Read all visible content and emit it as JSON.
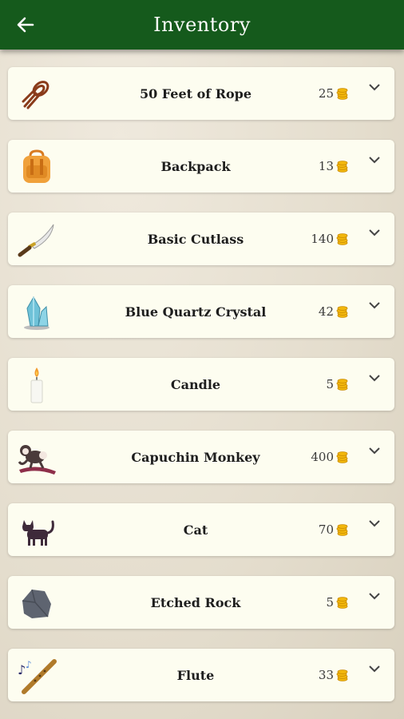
{
  "header": {
    "title": "Inventory",
    "back_icon": "arrow-left-icon",
    "bar_color": "#155a1c"
  },
  "items": [
    {
      "name": "50 Feet of Rope",
      "price": "25",
      "icon": "rope-icon"
    },
    {
      "name": "Backpack",
      "price": "13",
      "icon": "backpack-icon"
    },
    {
      "name": "Basic Cutlass",
      "price": "140",
      "icon": "cutlass-icon"
    },
    {
      "name": "Blue Quartz Crystal",
      "price": "42",
      "icon": "crystal-icon"
    },
    {
      "name": "Candle",
      "price": "5",
      "icon": "candle-icon"
    },
    {
      "name": "Capuchin Monkey",
      "price": "400",
      "icon": "monkey-icon"
    },
    {
      "name": "Cat",
      "price": "70",
      "icon": "cat-icon"
    },
    {
      "name": "Etched Rock",
      "price": "5",
      "icon": "rock-icon"
    },
    {
      "name": "Flute",
      "price": "33",
      "icon": "flute-icon"
    }
  ],
  "currency_icon": "gold-coins-icon",
  "expand_icon": "chevron-down-icon"
}
